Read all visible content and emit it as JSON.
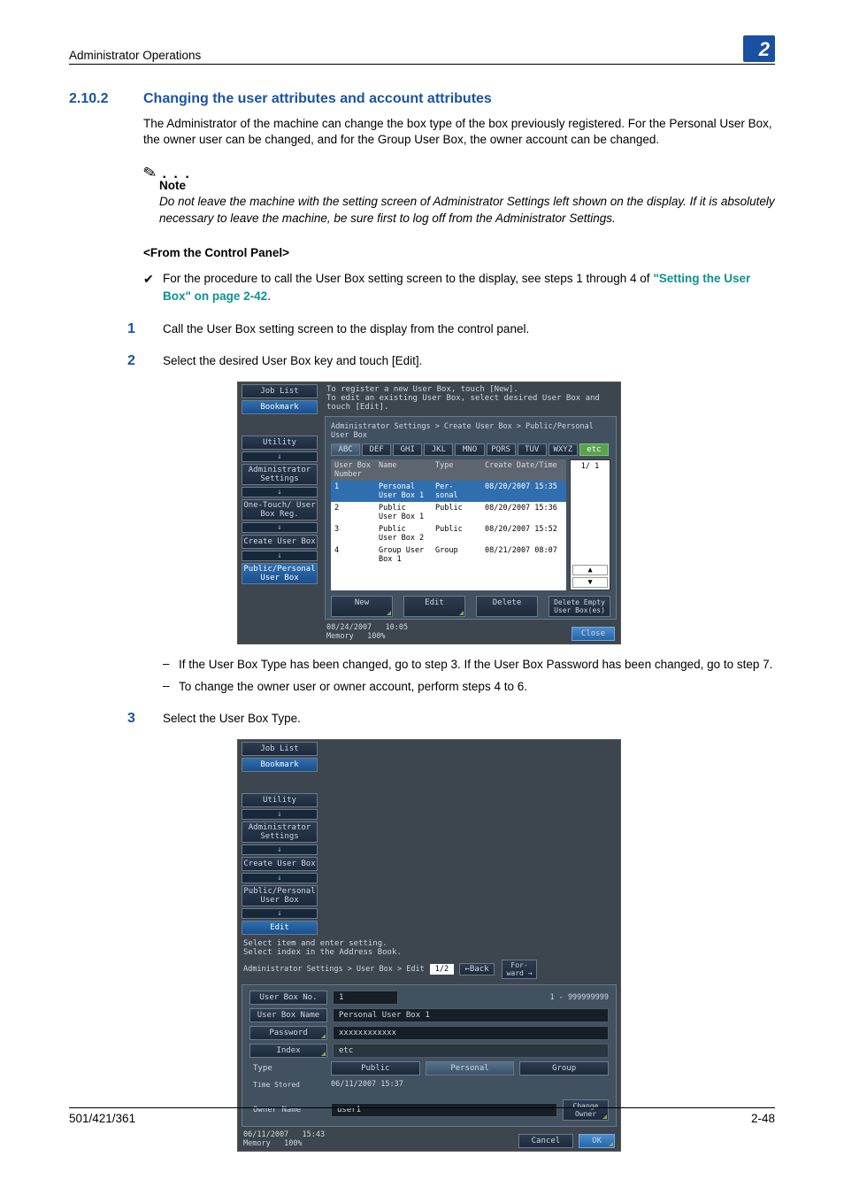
{
  "header": {
    "title": "Administrator Operations",
    "chapter": "2"
  },
  "sec": {
    "num": "2.10.2",
    "title": "Changing the user attributes and account attributes"
  },
  "para1": "The Administrator of the machine can change the box type of the box previously registered. For the Personal User Box, the owner user can be changed, and for the Group User Box, the owner account can be changed.",
  "note": {
    "label": "Note",
    "text": "Do not leave the machine with the setting screen of Administrator Settings left shown on the display. If it is absolutely necessary to leave the machine, be sure first to log off from the Administrator Settings."
  },
  "subhead": "<From the Control Panel>",
  "check1_a": "For the procedure to call the User Box setting screen to the display, see steps 1 through 4 of ",
  "check1_link": "\"Setting the User Box\" on page 2-42",
  "check1_b": ".",
  "step1": "Call the User Box setting screen to the display from the control panel.",
  "step2": "Select the desired User Box key and touch [Edit].",
  "after2_a": "If the User Box Type has been changed, go to step 3. If the User Box Password has been changed, go to step 7.",
  "after2_b": "To change the owner user or owner account, perform steps 4 to 6.",
  "step3": "Select the User Box Type.",
  "footer": {
    "left": "501/421/361",
    "right": "2-48"
  },
  "ss1": {
    "sidebar": {
      "joblist": "Job List",
      "bookmark": "Bookmark",
      "utility": "Utility",
      "admin": "Administrator Settings",
      "onetouch": "One-Touch/ User Box Reg.",
      "create": "Create User Box",
      "pp": "Public/Personal User Box"
    },
    "msg1": "To register a new User Box, touch [New].",
    "msg2": "To edit an existing User Box, select desired User Box and touch [Edit].",
    "breadcrumb": "Administrator Settings > Create User Box > Public/Personal User Box",
    "tabs": [
      "ABC",
      "DEF",
      "GHI",
      "JKL",
      "MNO",
      "PQRS",
      "TUV",
      "WXYZ",
      "etc"
    ],
    "cols": {
      "no": "User Box Number",
      "name": "Name",
      "type": "Type",
      "date": "Create Date/Time"
    },
    "rows": [
      {
        "no": "1",
        "name": "Personal User Box 1",
        "type": "Per- sonal",
        "date": "08/20/2007 15:35",
        "sel": true
      },
      {
        "no": "2",
        "name": "Public User Box 1",
        "type": "Public",
        "date": "08/20/2007 15:36"
      },
      {
        "no": "3",
        "name": "Public User Box 2",
        "type": "Public",
        "date": "08/20/2007 15:52"
      },
      {
        "no": "4",
        "name": "Group User Box 1",
        "type": "Group",
        "date": "08/21/2007 08:07"
      }
    ],
    "page": "1/  1",
    "btns": {
      "new": "New",
      "edit": "Edit",
      "del": "Delete",
      "delempty": "Delete Empty User Box(es)"
    },
    "status_date": "08/24/2007",
    "status_time": "10:05",
    "status_mem": "Memory",
    "status_pct": "100%",
    "close": "Close"
  },
  "ss2": {
    "sidebar": {
      "joblist": "Job List",
      "bookmark": "Bookmark",
      "utility": "Utility",
      "admin": "Administrator Settings",
      "create": "Create User Box",
      "pp": "Public/Personal User Box",
      "edit": "Edit"
    },
    "msg1": "Select item and enter setting.",
    "msg2": "Select index in the Address Book.",
    "breadcrumb": "Administrator Settings > User Box > Edit",
    "page": "1/2",
    "back": "←Back",
    "fwd": "For- ward",
    "range": "1 - 999999999",
    "fields": {
      "no_label": "User Box No.",
      "no_val": "1",
      "name_label": "User Box Name",
      "name_val": "Personal User Box 1",
      "pwd_label": "Password",
      "pwd_val": "xxxxxxxxxxxx",
      "idx_label": "Index",
      "idx_val": "etc",
      "type_label": "Type",
      "types": [
        "Public",
        "Personal",
        "Group"
      ],
      "time_label": "Time Stored",
      "time_val": "06/11/2007  15:37",
      "owner_label": "Owner Name",
      "owner_val": "user1",
      "chown": "Change Owner"
    },
    "cancel": "Cancel",
    "ok": "OK",
    "status_date": "06/11/2007",
    "status_time": "15:43",
    "status_mem": "Memory",
    "status_pct": "100%"
  }
}
